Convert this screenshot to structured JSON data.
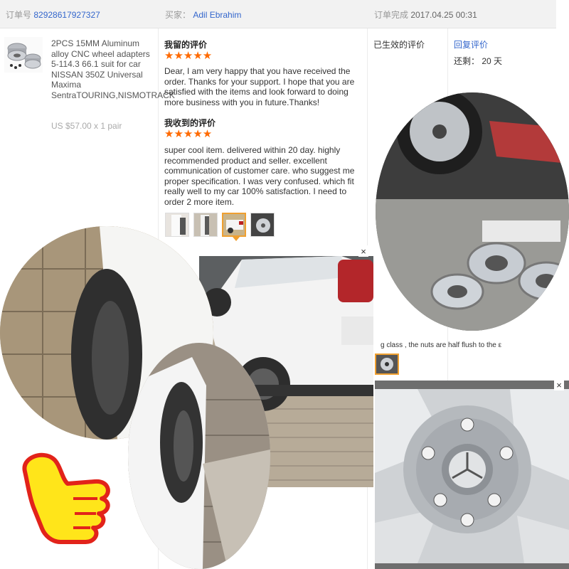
{
  "order": {
    "id_label": "订单号",
    "id_value": "82928617927327",
    "buyer_label": "买家：",
    "buyer_value": "Adil Ebrahim",
    "completed_label": "订单完成",
    "completed_value": "2017.04.25 00:31"
  },
  "product": {
    "title": "2PCS 15MM Aluminum alloy CNC wheel adapters 5-114.3 66.1 suit for car NISSAN 350Z Universal Maxima SentraTOURING,NISMOTRACK",
    "price": "US $57.00 x 1 pair",
    "thumb_icon": "wheel-adapter-product-thumbnail"
  },
  "review": {
    "my_heading": "我留的评价",
    "my_stars": "★★★★★",
    "my_text": "Dear, I am very happy that you have received the order. Thanks for your support. I hope that you are satisfied with the items and look forward to doing more business with you in future.Thanks!",
    "received_heading": "我收到的评价",
    "received_stars": "★★★★★",
    "received_text": "super cool item. delivered within 20 day. highly recommended product and seller. excellent communication of customer care. who suggest me proper specification. I was very confused. which fit really well to my car 100% satisfaction. I need to order 2 more item.",
    "star_color": "#ff6a00",
    "thumbnails": [
      {
        "icon": "car-wheel-arch-photo-thumb"
      },
      {
        "icon": "car-side-photo-thumb"
      },
      {
        "icon": "white-suv-photo-thumb"
      },
      {
        "icon": "mercedes-hub-photo-thumb"
      }
    ]
  },
  "status": {
    "state": "已生效的评价",
    "reply_link": "回复评价",
    "remaining": "还剩： 20 天"
  },
  "overlays": {
    "close_symbol": "×",
    "caption_snippet": "g class , the nuts are half flush to the ε"
  },
  "colors": {
    "link": "#3366cc",
    "header_bg": "#f2f2f2",
    "thumbs_up": "#ffe51a",
    "thumbs_outline": "#e2231a"
  }
}
